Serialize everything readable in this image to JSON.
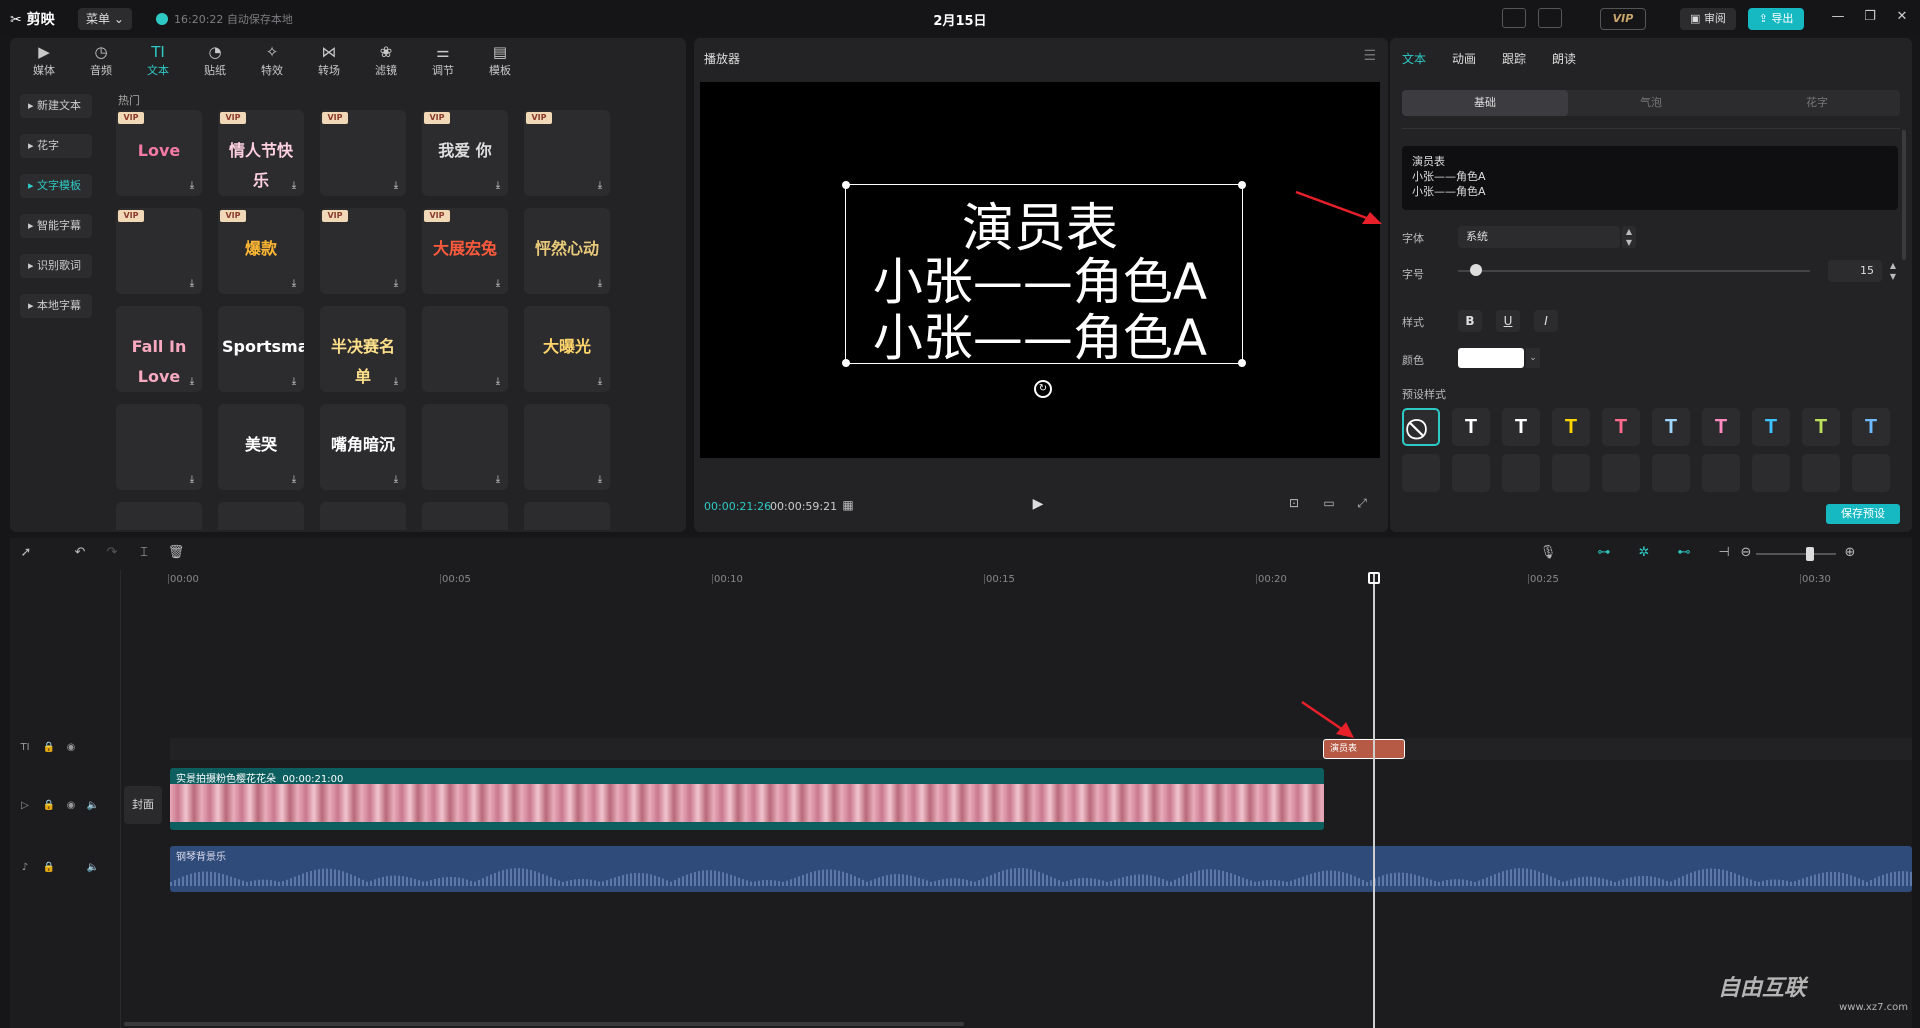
{
  "titlebar": {
    "app_name": "剪映",
    "menu_label": "菜单",
    "save_status": "16:20:22 自动保存本地",
    "project_title": "2月15日",
    "vip_label": "VIP",
    "review_label": "审阅",
    "export_label": "导出"
  },
  "media": {
    "tabs": [
      {
        "label": "媒体",
        "icon": "media-icon"
      },
      {
        "label": "音频",
        "icon": "audio-icon"
      },
      {
        "label": "文本",
        "icon": "text-icon"
      },
      {
        "label": "贴纸",
        "icon": "sticker-icon"
      },
      {
        "label": "特效",
        "icon": "effects-icon"
      },
      {
        "label": "转场",
        "icon": "transition-icon"
      },
      {
        "label": "滤镜",
        "icon": "filter-icon"
      },
      {
        "label": "调节",
        "icon": "adjust-icon"
      },
      {
        "label": "模板",
        "icon": "template-icon"
      }
    ],
    "active_tab": "文本",
    "side_items": [
      "新建文本",
      "花字",
      "文字模板",
      "智能字幕",
      "识别歌词",
      "本地字幕"
    ],
    "active_side": "文字模板",
    "section_label": "热门",
    "vip_badge": "VIP",
    "templates": [
      {
        "art": "Love",
        "color": "#f47aa5",
        "vip": true
      },
      {
        "art": "情人节快乐",
        "color": "#ffd0e0",
        "vip": true
      },
      {
        "art": "",
        "color": "#888",
        "vip": true
      },
      {
        "art": "我爱 你",
        "color": "#ddd",
        "vip": true
      },
      {
        "art": "",
        "color": "#999",
        "vip": true
      },
      {
        "art": "",
        "color": "#ffcc66",
        "vip": true
      },
      {
        "art": "爆款",
        "color": "#ffb733",
        "vip": true
      },
      {
        "art": "",
        "color": "#ff9966",
        "vip": true
      },
      {
        "art": "大展宏兔",
        "color": "#ff5a3c",
        "vip": true
      },
      {
        "art": "怦然心动",
        "color": "#e8c97a",
        "vip": false
      },
      {
        "art": "Fall In Love",
        "color": "#f7a9c0",
        "vip": false
      },
      {
        "art": "Sportsman",
        "color": "#fff",
        "vip": false
      },
      {
        "art": "半决赛名单",
        "color": "#ffe08a",
        "vip": false
      },
      {
        "art": "",
        "color": "#f06",
        "vip": false
      },
      {
        "art": "大曝光",
        "color": "#ffd56b",
        "vip": false
      },
      {
        "art": "",
        "color": "#bbb",
        "vip": false
      },
      {
        "art": "美哭",
        "color": "#fff",
        "vip": false
      },
      {
        "art": "嘴角暗沉",
        "color": "#fff",
        "vip": false
      },
      {
        "art": "",
        "color": "#ffe",
        "vip": false
      },
      {
        "art": "",
        "color": "#aaa",
        "vip": false
      }
    ]
  },
  "player": {
    "title": "播放器",
    "cast_title": "演员表",
    "cast_line1": "小张——角色A",
    "cast_line2": "小张——角色A",
    "time_current": "00:00:21:26",
    "time_total": "00:00:59:21"
  },
  "props": {
    "tabs": [
      "文本",
      "动画",
      "跟踪",
      "朗读"
    ],
    "active_tab": "文本",
    "subtabs": [
      "基础",
      "气泡",
      "花字"
    ],
    "active_subtab": "基础",
    "text_content": [
      "演员表",
      "小张——角色A",
      "小张——角色A"
    ],
    "font_label": "字体",
    "font_value": "系统",
    "size_label": "字号",
    "size_value": "15",
    "style_label": "样式",
    "color_label": "颜色",
    "color_value": "#ffffff",
    "preset_label": "预设样式",
    "save_preset_label": "保存预设",
    "preset_colors": [
      "#ffffff",
      "#ffffff",
      "#ffd400",
      "#ff6b8a",
      "#9fd4ff",
      "#ff8ac0",
      "#3fc3ff",
      "#bde05a",
      "#6fb9ff"
    ]
  },
  "timeline": {
    "ruler_labels": [
      "00:00",
      "00:05",
      "00:10",
      "00:15",
      "00:20",
      "00:25",
      "00:30"
    ],
    "text_clip_label": "演员表",
    "video_clip_label": "实景拍摄粉色樱花花朵",
    "video_clip_duration": "00:00:21:00",
    "audio_clip_label": "钢琴背景乐",
    "cover_label": "封面"
  },
  "watermark": {
    "main": "自由互联",
    "sub": "www.xz7.com"
  }
}
